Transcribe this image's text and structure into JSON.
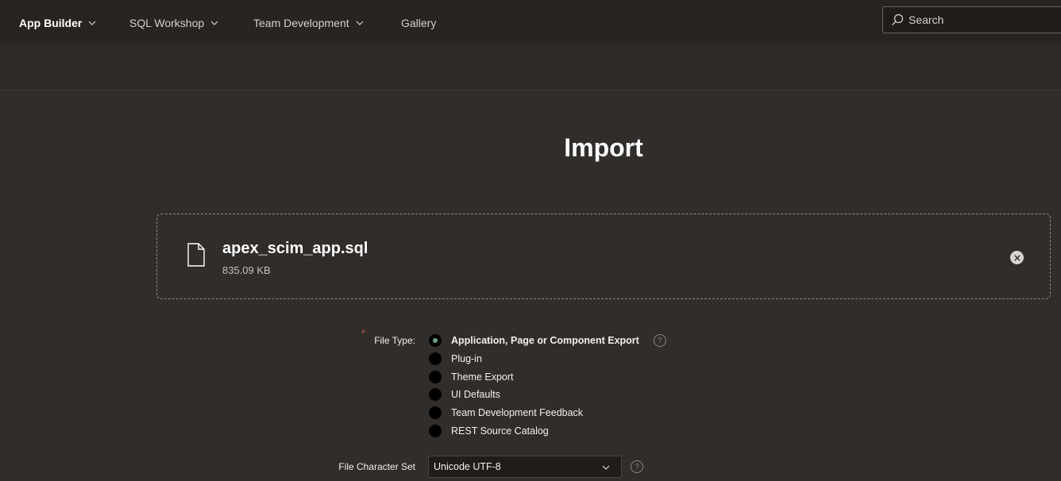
{
  "nav": {
    "items": [
      {
        "label": "App Builder",
        "active": true,
        "has_menu": true
      },
      {
        "label": "SQL Workshop",
        "active": false,
        "has_menu": true
      },
      {
        "label": "Team Development",
        "active": false,
        "has_menu": true
      },
      {
        "label": "Gallery",
        "active": false,
        "has_menu": false
      }
    ],
    "search_placeholder": "Search"
  },
  "page": {
    "title": "Import"
  },
  "upload": {
    "file_name": "apex_scim_app.sql",
    "file_size": "835.09 KB"
  },
  "form": {
    "file_type": {
      "label": "File Type:",
      "required_mark": "*",
      "options": [
        {
          "label": "Application, Page or Component Export",
          "checked": true
        },
        {
          "label": "Plug-in",
          "checked": false
        },
        {
          "label": "Theme Export",
          "checked": false
        },
        {
          "label": "UI Defaults",
          "checked": false
        },
        {
          "label": "Team Development Feedback",
          "checked": false
        },
        {
          "label": "REST Source Catalog",
          "checked": false
        }
      ],
      "help": "?"
    },
    "charset": {
      "label": "File Character Set",
      "value": "Unicode UTF-8",
      "help": "?"
    }
  },
  "colors": {
    "background": "#312d2a",
    "nav_background": "#282420",
    "radio_checked": "#5fa878",
    "required": "#e0534a"
  }
}
